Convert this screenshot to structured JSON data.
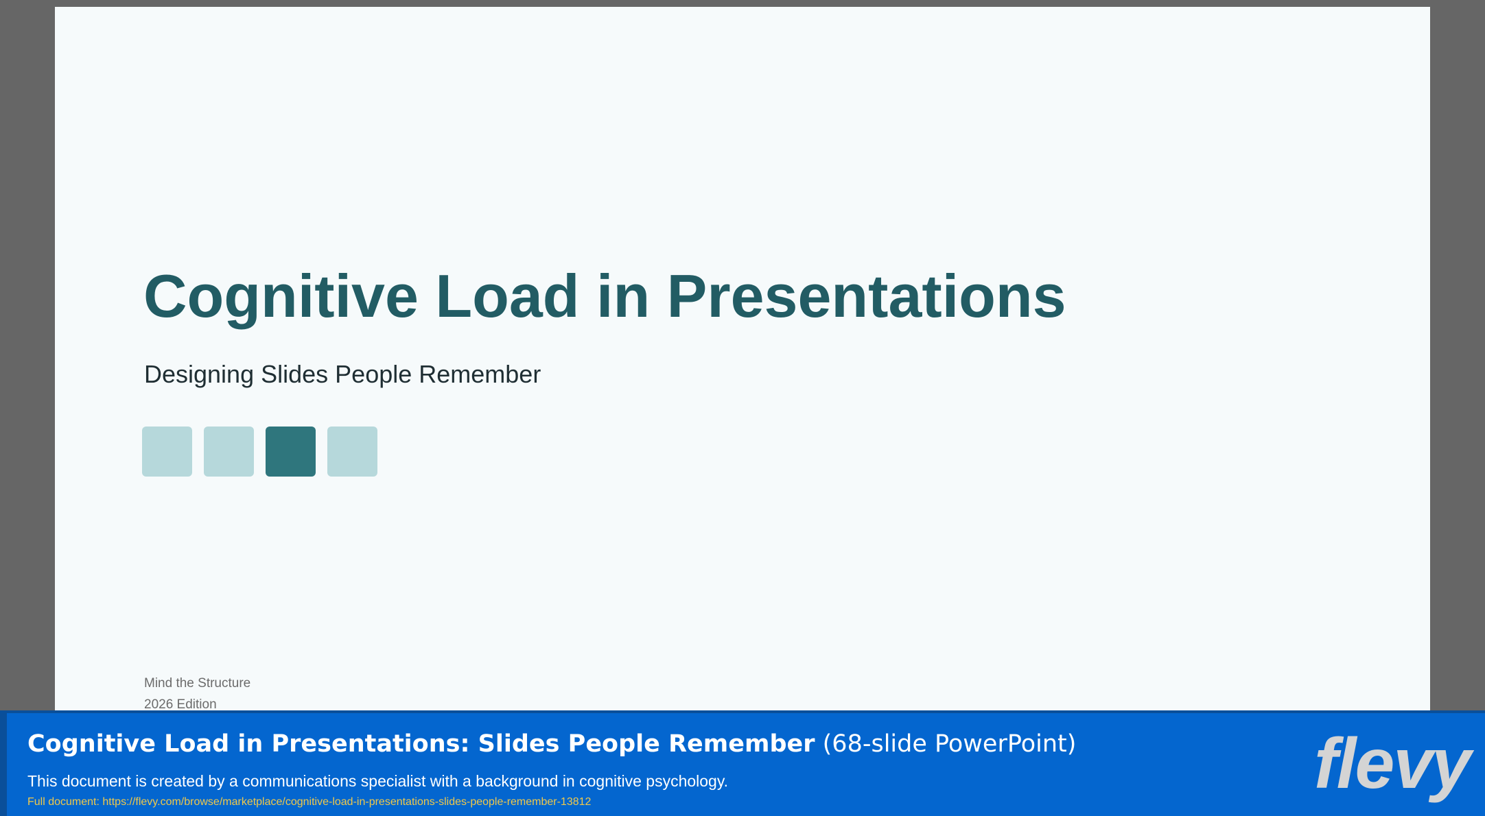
{
  "slide": {
    "title": "Cognitive Load in Presentations",
    "subtitle": "Designing Slides People Remember",
    "squares": [
      {
        "color": "#b6d8db"
      },
      {
        "color": "#b6d8db"
      },
      {
        "color": "#2f767d"
      },
      {
        "color": "#b6d8db"
      }
    ],
    "footer_line_1": "Mind the Structure",
    "footer_line_2": "2026 Edition"
  },
  "banner": {
    "title_bold": "Cognitive Load in Presentations: Slides People Remember",
    "title_light": "(68-slide PowerPoint)",
    "description": "This document is created by a communications specialist with a background in cognitive psychology.",
    "link_text": "Full document: https://flevy.com/browse/marketplace/cognitive-load-in-presentations-slides-people-remember-13812",
    "logo_text": "flevy"
  },
  "colors": {
    "page_background": "#666666",
    "slide_background": "#f6fafb",
    "title_color": "#225c64",
    "banner_background": "#0466cf",
    "link_color": "#f0c94a"
  }
}
